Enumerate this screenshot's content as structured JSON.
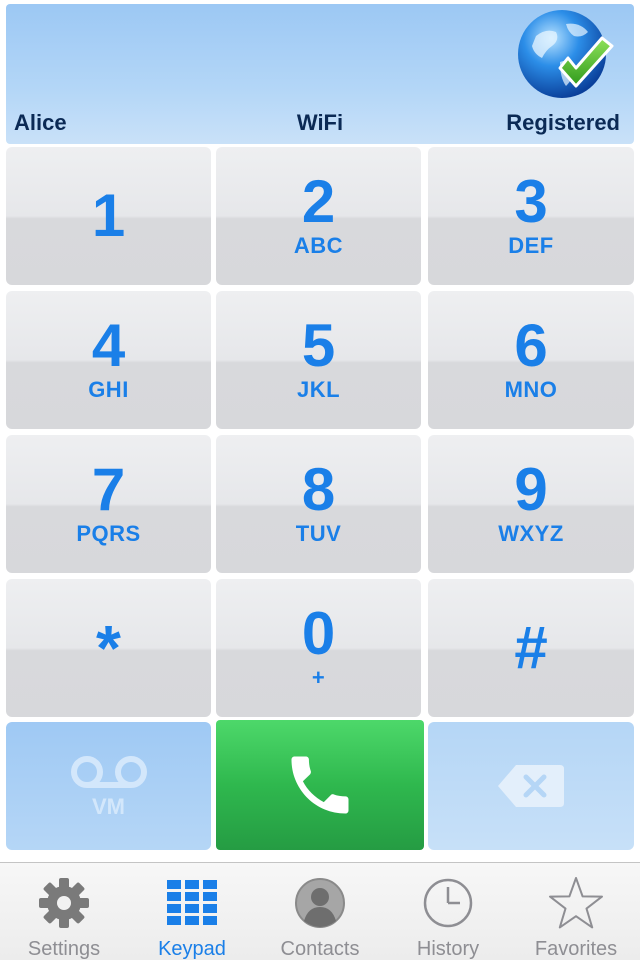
{
  "status": {
    "user": "Alice",
    "network": "WiFi",
    "registration": "Registered",
    "globe_icon": "globe-check-icon"
  },
  "keypad": [
    {
      "digit": "1",
      "letters": ""
    },
    {
      "digit": "2",
      "letters": "ABC"
    },
    {
      "digit": "3",
      "letters": "DEF"
    },
    {
      "digit": "4",
      "letters": "GHI"
    },
    {
      "digit": "5",
      "letters": "JKL"
    },
    {
      "digit": "6",
      "letters": "MNO"
    },
    {
      "digit": "7",
      "letters": "PQRS"
    },
    {
      "digit": "8",
      "letters": "TUV"
    },
    {
      "digit": "9",
      "letters": "WXYZ"
    },
    {
      "digit": "*",
      "letters": ""
    },
    {
      "digit": "0",
      "letters": "+"
    },
    {
      "digit": "#",
      "letters": ""
    }
  ],
  "actions": {
    "voicemail_label": "VM",
    "voicemail_icon": "voicemail-icon",
    "call_icon": "phone-handset-icon",
    "delete_icon": "backspace-icon"
  },
  "tabs": [
    {
      "label": "Settings",
      "icon": "gear-icon",
      "active": false
    },
    {
      "label": "Keypad",
      "icon": "keypad-grid-icon",
      "active": true
    },
    {
      "label": "Contacts",
      "icon": "person-icon",
      "active": false
    },
    {
      "label": "History",
      "icon": "clock-icon",
      "active": false
    },
    {
      "label": "Favorites",
      "icon": "star-icon",
      "active": false
    }
  ],
  "colors": {
    "accent": "#1a7fe8",
    "call_green": "#2fb84e",
    "status_bg": "#b3d6f7",
    "tab_inactive": "#8e8e93"
  }
}
